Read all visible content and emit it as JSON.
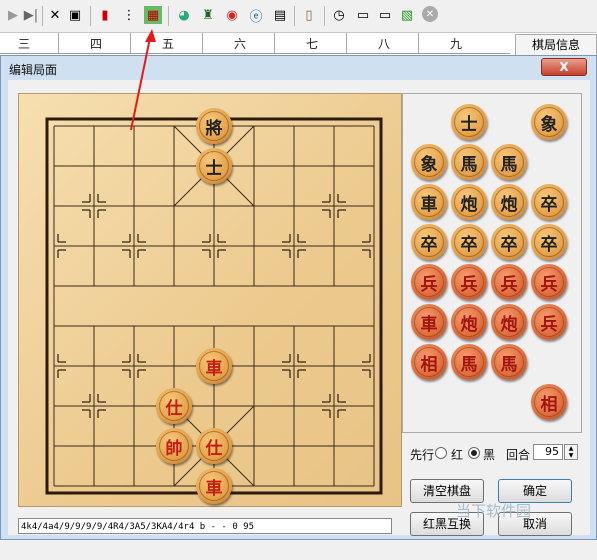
{
  "toolbar": {
    "icons": [
      "end-icon",
      "delete-icon",
      "paste-icon",
      "book-red-icon",
      "tree-icon",
      "grid-icon",
      "color-wheel-icon",
      "engine-icon",
      "weibo-icon",
      "browser-icon",
      "clipboard-icon",
      "open-book-icon",
      "clock-icon",
      "computer-icon",
      "computer-icon",
      "chart-icon",
      "close-circle-icon"
    ]
  },
  "files_ruler": [
    "三",
    "四",
    "五",
    "六",
    "七",
    "八",
    "九"
  ],
  "info_tab": "棋局信息",
  "dialog": {
    "title": "编辑局面",
    "close": "X"
  },
  "board_pieces": [
    {
      "char": "將",
      "side": "black"
    },
    {
      "char": "士",
      "side": "black"
    },
    {
      "char": "車",
      "side": "red"
    },
    {
      "char": "仕",
      "side": "red"
    },
    {
      "char": "帥",
      "side": "red"
    },
    {
      "char": "仕",
      "side": "red"
    },
    {
      "char": "車",
      "side": "red"
    }
  ],
  "palette_pieces": [
    {
      "char": "士",
      "side": "black"
    },
    {
      "char": "象",
      "side": "black"
    },
    {
      "char": "象",
      "side": "black"
    },
    {
      "char": "馬",
      "side": "black"
    },
    {
      "char": "馬",
      "side": "black"
    },
    {
      "char": "車",
      "side": "black"
    },
    {
      "char": "炮",
      "side": "black"
    },
    {
      "char": "炮",
      "side": "black"
    },
    {
      "char": "卒",
      "side": "black"
    },
    {
      "char": "卒",
      "side": "black"
    },
    {
      "char": "卒",
      "side": "black"
    },
    {
      "char": "卒",
      "side": "black"
    },
    {
      "char": "卒",
      "side": "black"
    },
    {
      "char": "兵",
      "side": "red"
    },
    {
      "char": "兵",
      "side": "red"
    },
    {
      "char": "兵",
      "side": "red"
    },
    {
      "char": "兵",
      "side": "red"
    },
    {
      "char": "車",
      "side": "red"
    },
    {
      "char": "炮",
      "side": "red"
    },
    {
      "char": "炮",
      "side": "red"
    },
    {
      "char": "兵",
      "side": "red"
    },
    {
      "char": "相",
      "side": "red"
    },
    {
      "char": "馬",
      "side": "red"
    },
    {
      "char": "馬",
      "side": "red"
    },
    {
      "char": "相",
      "side": "red"
    }
  ],
  "controls": {
    "first_move_label": "先行",
    "red_label": "红",
    "black_label": "黑",
    "selected": "black",
    "round_label": "回合",
    "round_value": "95",
    "clear_board": "清空棋盘",
    "swap": "红黑互换",
    "ok": "确定",
    "cancel": "取消"
  },
  "fen": "4k4/4a4/9/9/9/9/4R4/3A5/3KA4/4r4 b - - 0 95",
  "watermark": "当下软件园"
}
